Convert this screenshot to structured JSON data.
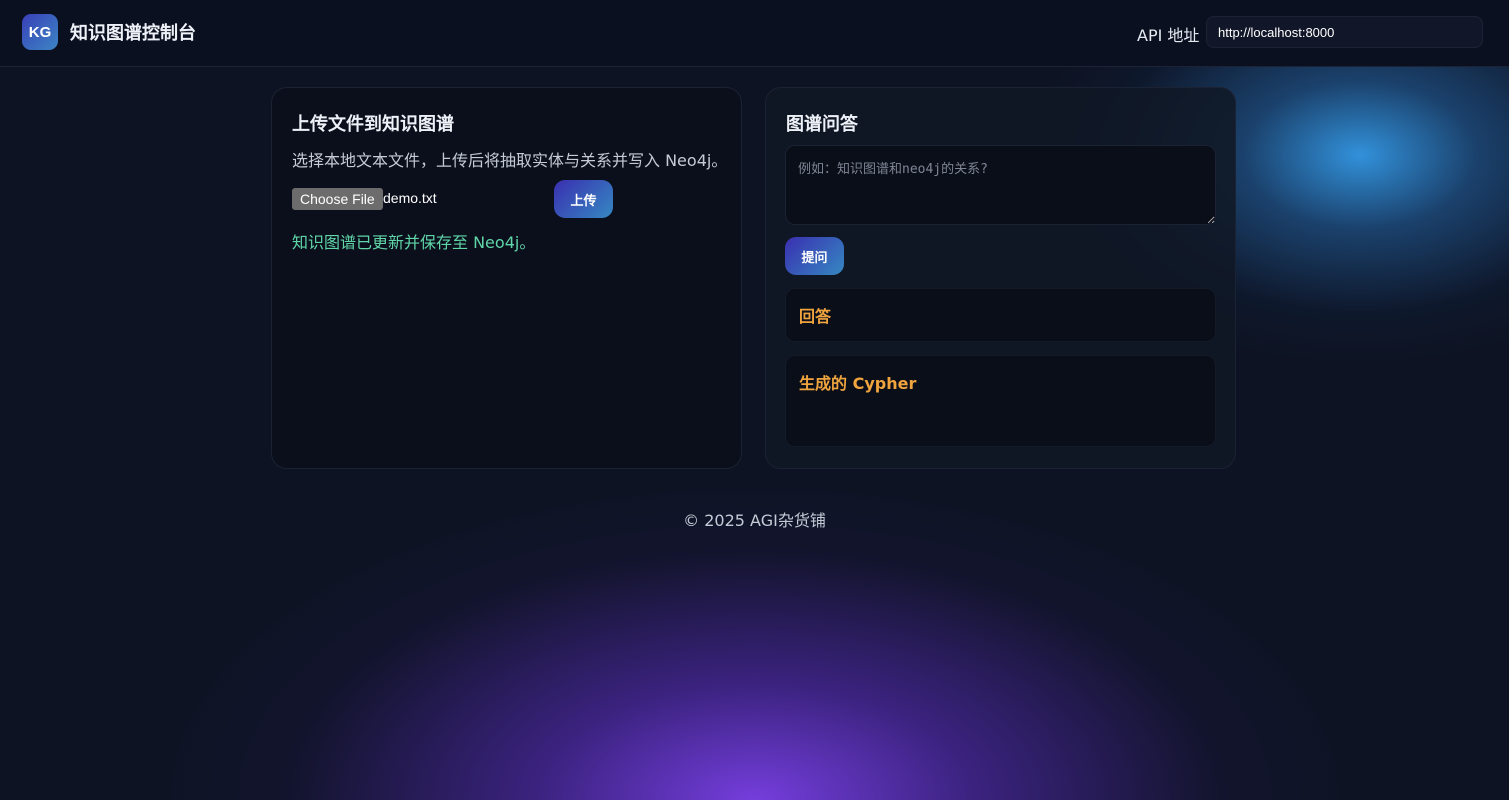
{
  "header": {
    "logo_text": "KG",
    "title": "知识图谱控制台",
    "api_label": "API 地址",
    "api_value": "http://localhost:8000"
  },
  "upload_panel": {
    "title": "上传文件到知识图谱",
    "description": "选择本地文本文件，上传后将抽取实体与关系并写入 Neo4j。",
    "choose_file_label": "Choose File",
    "file_name": "demo.txt",
    "upload_button": "上传",
    "status": "知识图谱已更新并保存至 Neo4j。"
  },
  "qa_panel": {
    "title": "图谱问答",
    "question_placeholder": "例如：知识图谱和neo4j的关系?",
    "ask_button": "提问",
    "answer_title": "回答",
    "cypher_title": "生成的 Cypher"
  },
  "footer": {
    "text": "© 2025 AGI杂货铺"
  },
  "colors": {
    "background": "#0d1322",
    "accent_gradient_start": "#3a2fb0",
    "accent_gradient_end": "#3588c2",
    "success_text": "#60d6a8",
    "section_title": "#f0a43e"
  }
}
